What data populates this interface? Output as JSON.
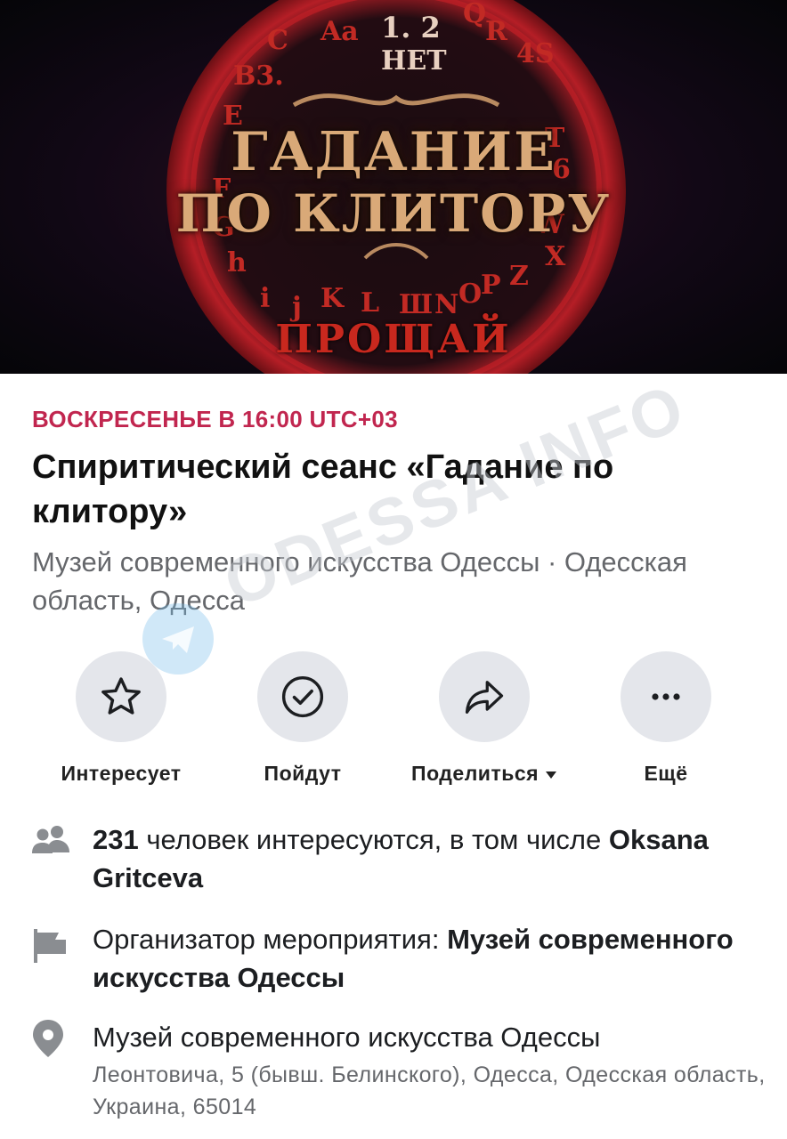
{
  "cover": {
    "title_line1": "ГАДАНИЕ",
    "title_line2": "ПО КЛИТОРУ",
    "bottom_word": "ПРОЩАЙ",
    "top_label": "НЕТ",
    "top_numbers": "1.  2"
  },
  "event": {
    "date": "ВОСКРЕСЕНЬЕ В 16:00 UTC+03",
    "title": "Спиритический сеанс «Гадание по клитору»",
    "location": "Музей современного искусства Одессы · Одесская область, Одесса"
  },
  "actions": [
    {
      "label": "Интересует",
      "icon": "star-icon"
    },
    {
      "label": "Пойдут",
      "icon": "check-circle-icon"
    },
    {
      "label": "Поделиться",
      "icon": "share-icon",
      "suffix": "caret-down-icon"
    },
    {
      "label": "Ещё",
      "icon": "more-icon"
    }
  ],
  "details": {
    "interested_count": "231",
    "interested_text": " человек интересуются, в том числе ",
    "interested_person": "Oksana Gritceva",
    "organizer_label": "Организатор мероприятия: ",
    "organizer_name": "Музей современного искусства Одессы",
    "place_name": "Музей современного искусства Одессы",
    "place_address": "Леонтовича, 5 (бывш. Белинского), Одесса, Одесская область, Украина, 65014"
  },
  "watermark": {
    "text": "ODESSA INFO"
  },
  "colors": {
    "date_accent": "#c1264f",
    "button_bg": "#e4e6eb",
    "secondary_text": "#65676b"
  }
}
